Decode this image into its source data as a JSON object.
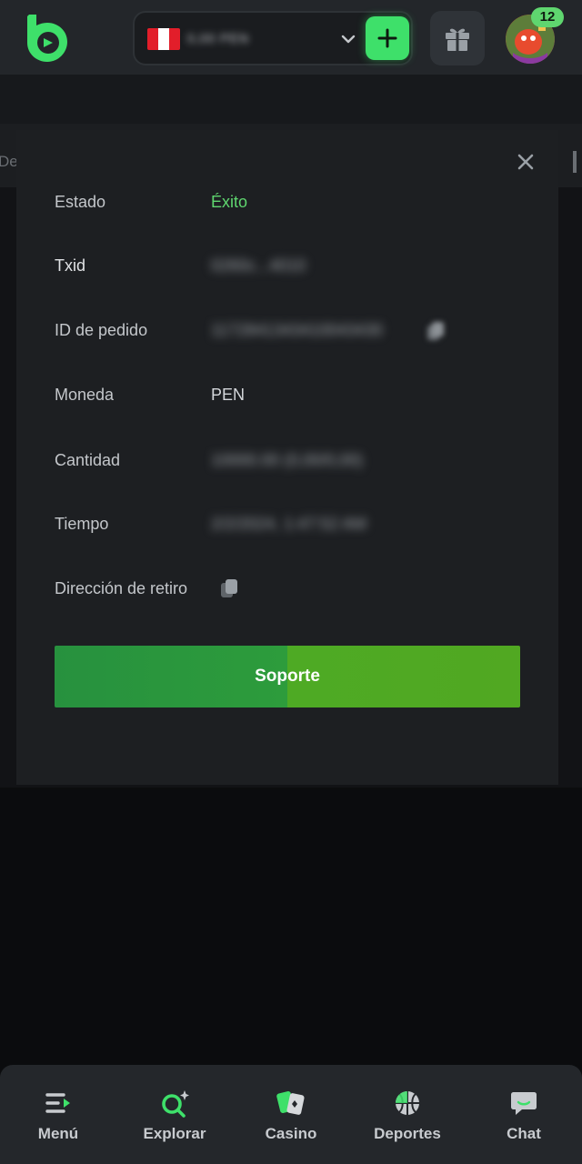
{
  "header": {
    "logo_icon": "bc-logo-icon",
    "flag_icon": "peru-flag-icon",
    "balance_text": "0,00 PEN",
    "deposit_icon": "plus-icon",
    "gift_icon": "gift-icon",
    "avatar_icon": "user-avatar",
    "notification_count": "12",
    "accent_color": "#3ee06a"
  },
  "background": {
    "partial_tab_text": "De"
  },
  "modal": {
    "close_icon": "close-icon",
    "rows": [
      {
        "label": "Estado",
        "value": "Éxito"
      },
      {
        "label": "Txid",
        "value": "0260c...4010"
      },
      {
        "label": "ID de pedido",
        "value": "1172841343410043430"
      },
      {
        "label": "Moneda",
        "value": "PEN"
      },
      {
        "label": "Cantidad",
        "value": "10000.00 (0,00/0,00)"
      },
      {
        "label": "Tiempo",
        "value": "2/2/2024, 1:47:52 AM"
      },
      {
        "label": "Dirección de retiro",
        "value": ""
      }
    ],
    "support_button": "Soporte",
    "success_color": "#5fd66f"
  },
  "bottom_nav": {
    "items": [
      {
        "label": "Menú",
        "icon": "menu-icon"
      },
      {
        "label": "Explorar",
        "icon": "search-sparkle-icon"
      },
      {
        "label": "Casino",
        "icon": "cards-icon"
      },
      {
        "label": "Deportes",
        "icon": "basketball-icon"
      },
      {
        "label": "Chat",
        "icon": "chat-icon"
      }
    ]
  }
}
